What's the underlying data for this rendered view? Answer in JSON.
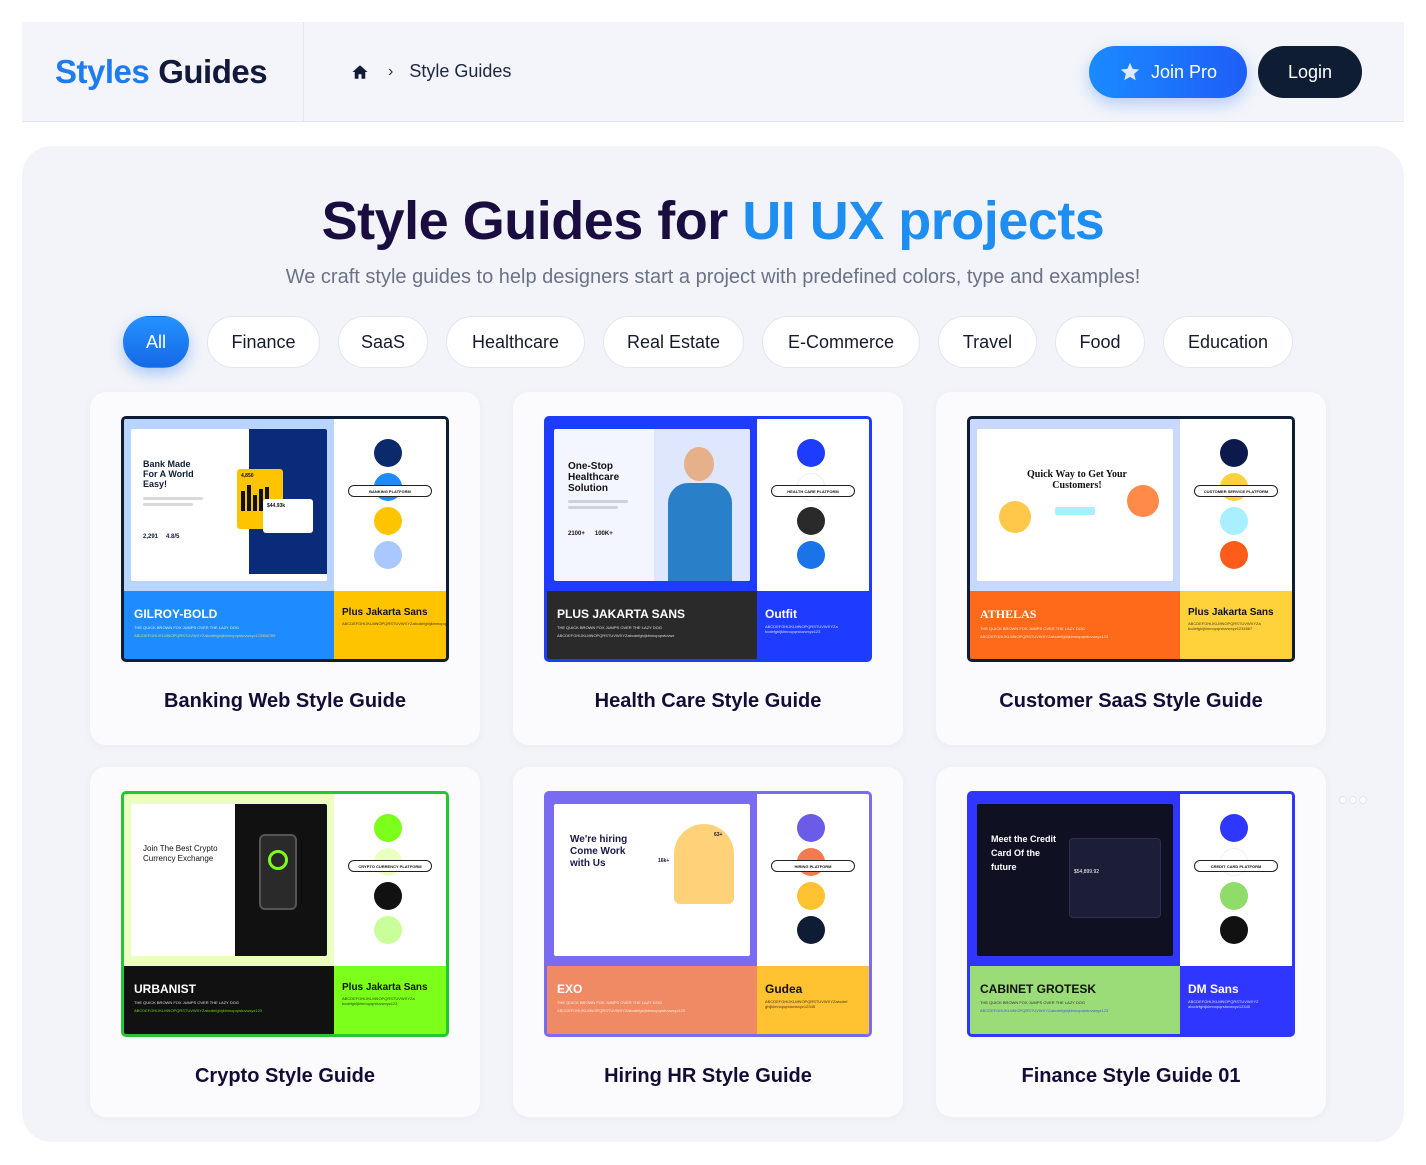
{
  "header": {
    "logo_part1": "Styles",
    "logo_part2": "Guides",
    "breadcrumb_current": "Style Guides",
    "join_pro_label": "Join Pro",
    "login_label": "Login"
  },
  "hero": {
    "title_main": "Style Guides for ",
    "title_accent": "UI UX projects",
    "subtitle": "We craft style guides to help designers start a project with predefined colors, type and examples!"
  },
  "filters": [
    "All",
    "Finance",
    "SaaS",
    "Healthcare",
    "Real Estate",
    "E-Commerce",
    "Travel",
    "Food",
    "Education"
  ],
  "active_filter": "All",
  "cards": [
    {
      "title": "Banking Web Style Guide",
      "frame_color": "#0e1d33",
      "hero_text": "Bank Made For A World Easy!",
      "stats": [
        "2,291",
        "4.8/5",
        "4,850",
        "$44.93k"
      ],
      "platform_label": "BANKING PLATFORM",
      "colors": [
        "#0b2a6b",
        "#1e8bff",
        "#ffc400",
        "#a9c8ff"
      ],
      "heading_font": "GILROY-BOLD",
      "heading_bg": "#1e8bff",
      "body_font": "Plus Jakarta Sans",
      "body_bg": "#ffc400"
    },
    {
      "title": "Health Care Style Guide",
      "frame_color": "#1e3cff",
      "hero_text": "One-Stop Healthcare Solution",
      "stats": [
        "2100+",
        "100K+"
      ],
      "platform_label": "HEALTH CARE PLATFORM",
      "colors": [
        "#1e3cff",
        "#ffffff",
        "#2a2a2a",
        "#1a73e8"
      ],
      "heading_font": "PLUS JAKARTA SANS",
      "heading_bg": "#2a2a2a",
      "body_font": "Outfit",
      "body_bg": "#1e3cff"
    },
    {
      "title": "Customer SaaS Style Guide",
      "frame_color": "#0e1d33",
      "hero_text": "Quick Way to Get Your Customers!",
      "stats": [],
      "platform_label": "CUSTOMER SERVICE PLATFORM",
      "colors": [
        "#0b1a4a",
        "#ffd23c",
        "#a8f0ff",
        "#ff5b1a"
      ],
      "heading_font": "ATHELAS",
      "heading_bg": "#ff6a1a",
      "body_font": "Plus Jakarta Sans",
      "body_bg": "#ffd23c"
    },
    {
      "title": "Crypto Style Guide",
      "frame_color": "#22c832",
      "hero_text": "Join The Best Crypto Currency Exchange",
      "stats": [],
      "platform_label": "CRYPTO CURRENCY PLATFORM",
      "colors": [
        "#7cff1a",
        "#eaffc0",
        "#111111",
        "#c8ff9a"
      ],
      "heading_font": "URBANIST",
      "heading_bg": "#111111",
      "body_font": "Plus Jakarta Sans",
      "body_bg": "#7cff1a"
    },
    {
      "title": "Hiring HR Style Guide",
      "frame_color": "#7a6cf0",
      "hero_text": "We're hiring Come Work with Us",
      "stats": [
        "63+",
        "16k+"
      ],
      "platform_label": "HIRING PLATFORM",
      "colors": [
        "#6b5ce7",
        "#f07c50",
        "#ffc230",
        "#0e1d33"
      ],
      "heading_font": "EXO",
      "heading_bg": "#f08a65",
      "body_font": "Gudea",
      "body_bg": "#ffc230"
    },
    {
      "title": "Finance Style Guide 01",
      "frame_color": "#2e36ff",
      "hero_text": "Meet the Credit Card Of the future",
      "stats": [
        "$54,899.92"
      ],
      "platform_label": "CREDIT CARD PLATFORM",
      "colors": [
        "#2e36ff",
        "#ffffff",
        "#8fdc6a",
        "#111111"
      ],
      "heading_font": "CABINET GROTESK",
      "heading_bg": "#9bdc78",
      "body_font": "DM Sans",
      "body_bg": "#2e36ff"
    }
  ]
}
